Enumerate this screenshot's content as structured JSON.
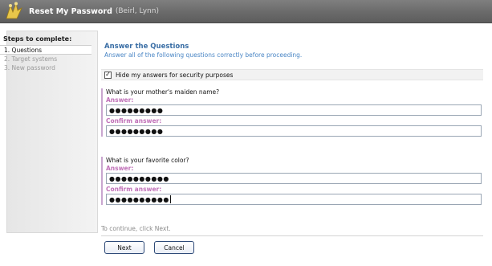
{
  "window": {
    "title": "Reset My Password",
    "user": "(Beirl, Lynn)",
    "icon": "app-logo-icon"
  },
  "sidebar": {
    "heading": "Steps to complete:",
    "steps": [
      {
        "label": "1. Questions",
        "state": "active"
      },
      {
        "label": "2. Target systems",
        "state": "inactive"
      },
      {
        "label": "3. New password",
        "state": "inactive"
      }
    ]
  },
  "main": {
    "heading": "Answer the Questions",
    "subheading": "Answer all of the following questions correctly before proceeding.",
    "hide_answers": {
      "label": "Hide my answers for security purposes",
      "checked": true,
      "check_glyph": "✓"
    },
    "questions": [
      {
        "question": "What is your mother's maiden name?",
        "answer_label": "Answer:",
        "answer_value": "●●●●●●●●●",
        "confirm_label": "Confirm answer:",
        "confirm_value": "●●●●●●●●●"
      },
      {
        "question": "What is your favorite color?",
        "answer_label": "Answer:",
        "answer_value": "●●●●●●●●●●",
        "confirm_label": "Confirm answer:",
        "confirm_value": "●●●●●●●●●●"
      }
    ],
    "continue_text": "To continue, click Next."
  },
  "buttons": {
    "next": "Next",
    "cancel": "Cancel"
  },
  "colors": {
    "titlebar": "#6a6a6a",
    "heading": "#3a6ea5",
    "field_label": "#c070b8",
    "question_bar": "#c9a6cf"
  }
}
